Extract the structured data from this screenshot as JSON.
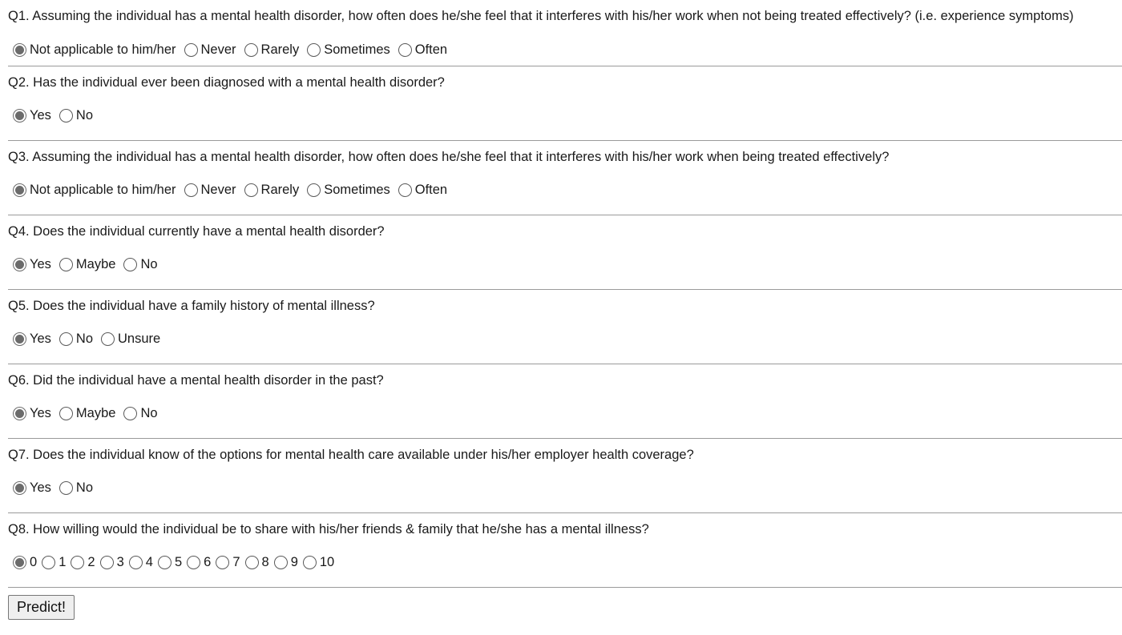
{
  "questions": [
    {
      "text": "Q1. Assuming the individual has a mental health disorder, how often does he/she feel that it interferes with his/her work when not being treated effectively? (i.e. experience symptoms)",
      "options": [
        "Not applicable to him/her",
        "Never",
        "Rarely",
        "Sometimes",
        "Often"
      ],
      "selected": 0
    },
    {
      "text": "Q2. Has the individual ever been diagnosed with a mental health disorder?",
      "options": [
        "Yes",
        "No"
      ],
      "selected": 0
    },
    {
      "text": "Q3. Assuming the individual has a mental health disorder, how often does he/she feel that it interferes with his/her work when being treated effectively?",
      "options": [
        "Not applicable to him/her",
        "Never",
        "Rarely",
        "Sometimes",
        "Often"
      ],
      "selected": 0
    },
    {
      "text": "Q4. Does the individual currently have a mental health disorder?",
      "options": [
        "Yes",
        "Maybe",
        "No"
      ],
      "selected": 0
    },
    {
      "text": "Q5. Does the individual have a family history of mental illness?",
      "options": [
        "Yes",
        "No",
        "Unsure"
      ],
      "selected": 0
    },
    {
      "text": "Q6. Did the individual have a mental health disorder in the past?",
      "options": [
        "Yes",
        "Maybe",
        "No"
      ],
      "selected": 0
    },
    {
      "text": "Q7. Does the individual know of the options for mental health care available under his/her employer health coverage?",
      "options": [
        "Yes",
        "No"
      ],
      "selected": 0
    },
    {
      "text": "Q8. How willing would the individual be to share with his/her friends & family that he/she has a mental illness?",
      "options": [
        "0",
        "1",
        "2",
        "3",
        "4",
        "5",
        "6",
        "7",
        "8",
        "9",
        "10"
      ],
      "selected": 0,
      "compact": true
    }
  ],
  "submit_label": "Predict!"
}
